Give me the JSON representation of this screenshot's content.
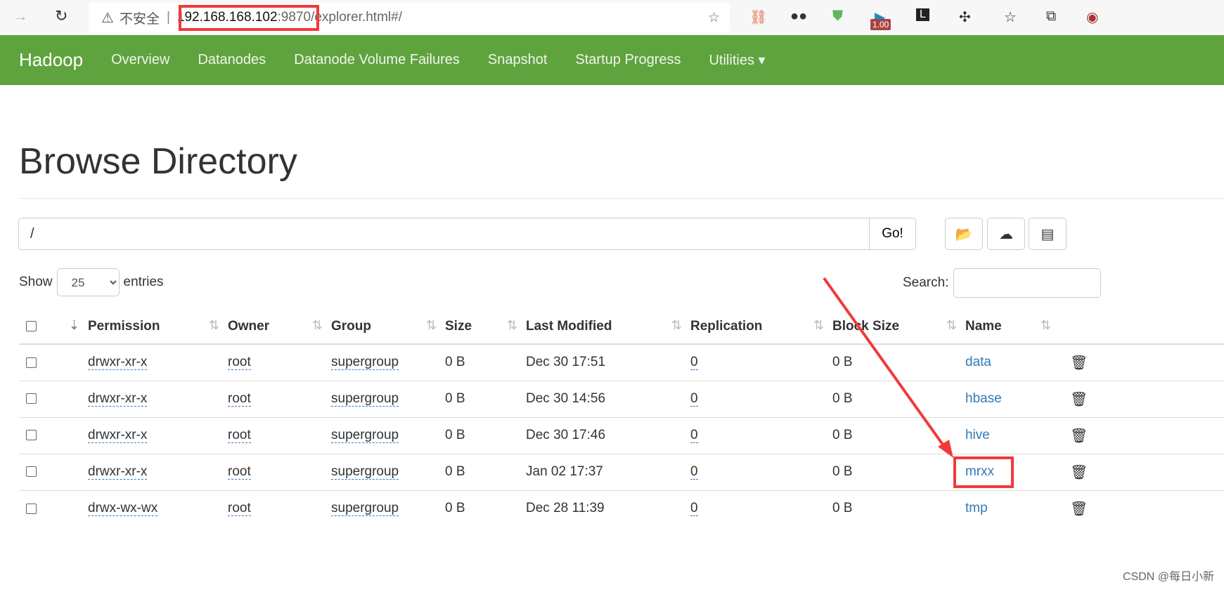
{
  "browser": {
    "insecure_label": "不安全",
    "url_host": "192.168.168.102",
    "url_port": ":9870",
    "url_path": "/explorer.html#/",
    "ext_badge": "1.00"
  },
  "nav": {
    "brand": "Hadoop",
    "items": [
      "Overview",
      "Datanodes",
      "Datanode Volume Failures",
      "Snapshot",
      "Startup Progress",
      "Utilities ▾"
    ]
  },
  "page_title": "Browse Directory",
  "path": {
    "value": "/",
    "go": "Go!"
  },
  "show": {
    "label": "Show",
    "value": "25",
    "suffix": "entries"
  },
  "search": {
    "label": "Search:",
    "value": ""
  },
  "columns": [
    "Permission",
    "Owner",
    "Group",
    "Size",
    "Last Modified",
    "Replication",
    "Block Size",
    "Name"
  ],
  "rows": [
    [
      "drwxr-xr-x",
      "root",
      "supergroup",
      "0 B",
      "Dec 30 17:51",
      "0",
      "0 B",
      "data"
    ],
    [
      "drwxr-xr-x",
      "root",
      "supergroup",
      "0 B",
      "Dec 30 14:56",
      "0",
      "0 B",
      "hbase"
    ],
    [
      "drwxr-xr-x",
      "root",
      "supergroup",
      "0 B",
      "Dec 30 17:46",
      "0",
      "0 B",
      "hive"
    ],
    [
      "drwxr-xr-x",
      "root",
      "supergroup",
      "0 B",
      "Jan 02 17:37",
      "0",
      "0 B",
      "mrxx"
    ],
    [
      "drwx-wx-wx",
      "root",
      "supergroup",
      "0 B",
      "Dec 28 11:39",
      "0",
      "0 B",
      "tmp"
    ]
  ],
  "watermark": "CSDN @每日小新",
  "colors": {
    "navbar": "#5fa33e",
    "link": "#337ab7",
    "annotation": "#f03a3a"
  }
}
